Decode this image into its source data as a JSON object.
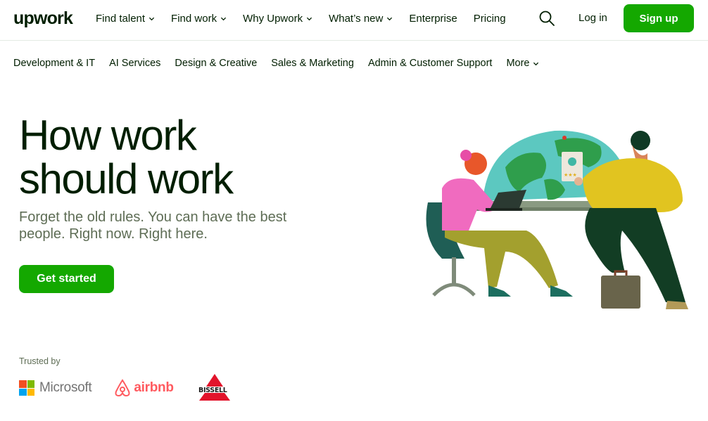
{
  "header": {
    "logo": "upwork",
    "nav": [
      {
        "label": "Find talent",
        "dropdown": true
      },
      {
        "label": "Find work",
        "dropdown": true
      },
      {
        "label": "Why Upwork",
        "dropdown": true
      },
      {
        "label": "What’s new",
        "dropdown": true
      },
      {
        "label": "Enterprise",
        "dropdown": false
      },
      {
        "label": "Pricing",
        "dropdown": false
      }
    ],
    "search_icon": "search-icon",
    "login": "Log in",
    "signup": "Sign up"
  },
  "categories": [
    "Development & IT",
    "AI Services",
    "Design & Creative",
    "Sales & Marketing",
    "Admin & Customer Support"
  ],
  "more_label": "More",
  "hero": {
    "title_line1": "How work",
    "title_line2": "should work",
    "subtitle": "Forget the old rules. You can have the best people. Right now. Right here.",
    "cta": "Get started"
  },
  "trusted": {
    "label": "Trusted by",
    "logos": [
      "Microsoft",
      "airbnb",
      "BISSELL"
    ]
  },
  "colors": {
    "brand_green": "#14a800",
    "text_dark": "#001e00",
    "text_muted": "#5e6d55"
  }
}
